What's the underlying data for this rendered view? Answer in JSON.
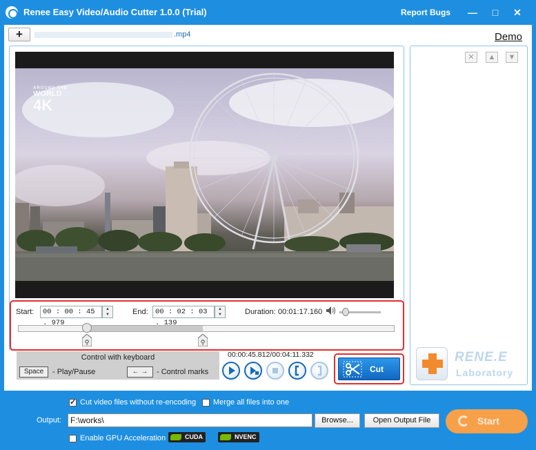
{
  "window": {
    "title": "Renee Easy Video/Audio Cutter 1.0.0 (Trial)",
    "report_bugs": "Report Bugs",
    "minimize": "—",
    "maximize": "□",
    "close": "✕"
  },
  "file_tab": {
    "add_label": "+",
    "file_name_suffix": ".mp4",
    "demo_link": "Demo"
  },
  "video": {
    "watermark_small": "AROUND THE",
    "watermark_world": "WORLD",
    "watermark_4k": "4K"
  },
  "cut_controls": {
    "start_label": "Start:",
    "start_time": "00 : 00 : 45 . 979",
    "end_label": "End:",
    "end_time": "00 : 02 : 03 . 139",
    "duration_label": "Duration:",
    "duration_value": "00:01:17.160",
    "volume_level": 0.15,
    "playhead_fraction": 0.183,
    "selection_start_fraction": 0.183,
    "selection_end_fraction": 0.49
  },
  "keyboard": {
    "title": "Control with keyboard",
    "space_key": "Space",
    "space_action": "- Play/Pause",
    "arrow_keys": "← →",
    "arrow_action": "- Control marks"
  },
  "playback": {
    "position_readout": "00:00:45.812/00:04:11.332",
    "cut_label": "Cut"
  },
  "list_panel": {
    "delete_icon": "✕",
    "up_icon": "▲",
    "down_icon": "▼"
  },
  "brand": {
    "name": "RENE.E",
    "lab": "Laboratory"
  },
  "bottom": {
    "cut_without_reencode": "Cut video files without re-encoding",
    "cut_without_reencode_checked": true,
    "merge_files": "Merge all files into one",
    "merge_files_checked": false,
    "output_label": "Output:",
    "output_path": "F:\\works\\",
    "browse_label": "Browse...",
    "open_output_label": "Open Output File",
    "gpu_label": "Enable GPU Acceleration",
    "gpu_checked": false,
    "cuda_label": "CUDA",
    "nvenc_label": "NVENC",
    "start_label": "Start"
  },
  "colors": {
    "accent": "#1e8fe0",
    "highlight_border": "#e32c2c",
    "start_button": "#f7a04a"
  }
}
